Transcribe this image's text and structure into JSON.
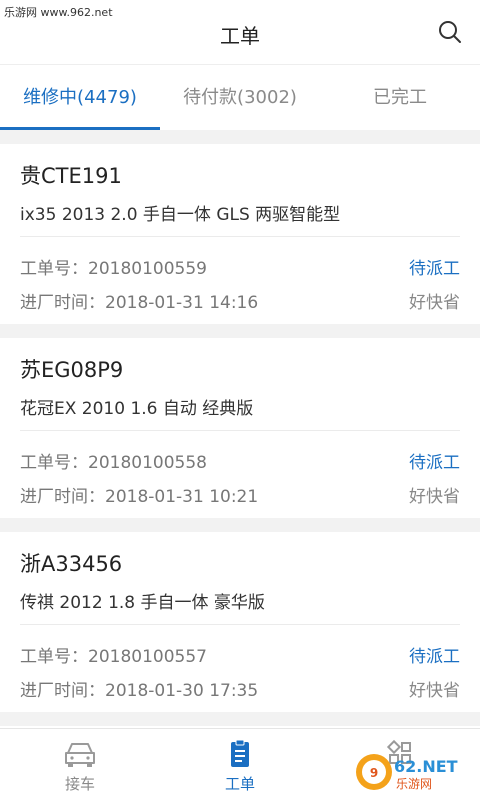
{
  "watermark": "乐游网 www.962.net",
  "header": {
    "title": "工单"
  },
  "tabs": [
    {
      "label": "维修中(4479)",
      "active": true
    },
    {
      "label": "待付款(3002)",
      "active": false
    },
    {
      "label": "已完工",
      "active": false
    }
  ],
  "orders": [
    {
      "plate": "贵CTE191",
      "model": "ix35 2013 2.0 手自一体 GLS 两驱智能型",
      "order_no": "工单号：20180100559",
      "status": "待派工",
      "entry_time": "进厂时间：2018-01-31 14:16",
      "shop": "好快省"
    },
    {
      "plate": "苏EG08P9",
      "model": "花冠EX 2010 1.6 自动 经典版",
      "order_no": "工单号：20180100558",
      "status": "待派工",
      "entry_time": "进厂时间：2018-01-31 10:21",
      "shop": "好快省"
    },
    {
      "plate": "浙A33456",
      "model": "传祺 2012 1.8 手自一体 豪华版",
      "order_no": "工单号：20180100557",
      "status": "待派工",
      "entry_time": "进厂时间：2018-01-30 17:35",
      "shop": "好快省"
    }
  ],
  "bottom_nav": [
    {
      "label": "接车",
      "icon": "car-icon",
      "active": false
    },
    {
      "label": "工单",
      "icon": "clipboard-icon",
      "active": true
    },
    {
      "label": "",
      "icon": "grid-icon",
      "active": false
    }
  ],
  "logo_text": "962.NET 乐游网",
  "colors": {
    "accent": "#1b6fc2",
    "background": "#f2f2f2"
  }
}
